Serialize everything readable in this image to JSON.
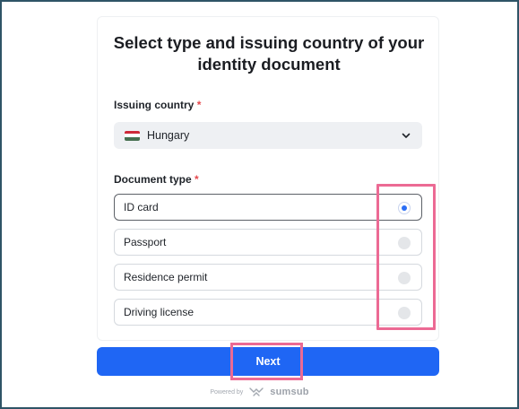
{
  "title": "Select type and issuing country of your identity document",
  "issuing_country": {
    "label": "Issuing country",
    "required_mark": "*",
    "selected_value": "Hungary",
    "flag_colors": [
      "#ce2939",
      "#ffffff",
      "#477050"
    ]
  },
  "document_type": {
    "label": "Document type",
    "required_mark": "*",
    "options": [
      {
        "label": "ID card",
        "selected": true
      },
      {
        "label": "Passport",
        "selected": false
      },
      {
        "label": "Residence permit",
        "selected": false
      },
      {
        "label": "Driving license",
        "selected": false
      }
    ]
  },
  "next_button": {
    "label": "Next"
  },
  "footer": {
    "powered_by": "Powered by",
    "brand": "sumsub"
  },
  "colors": {
    "accent": "#1f66f4",
    "highlight": "#ec6a94",
    "required": "#e5484d"
  }
}
